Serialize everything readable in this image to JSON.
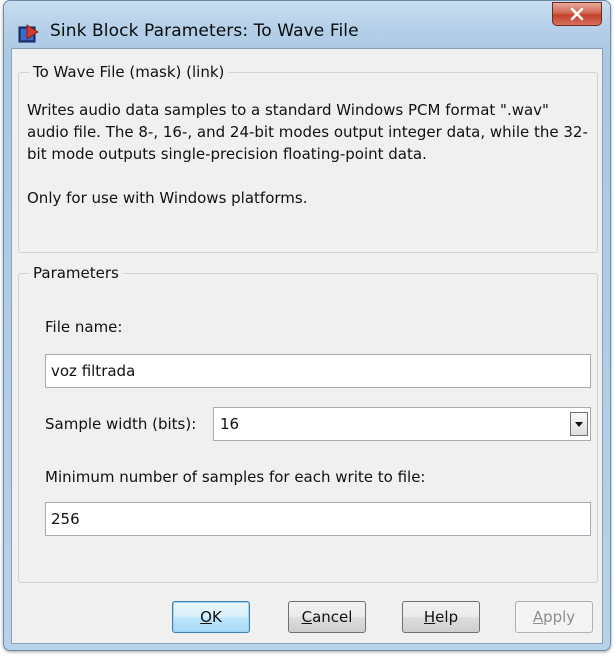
{
  "window": {
    "title": "Sink Block Parameters: To Wave File"
  },
  "description_group": {
    "legend": "To Wave File (mask) (link)",
    "paragraph1": "Writes audio data samples to a standard Windows PCM format \".wav\" audio file. The 8-, 16-, and 24-bit modes output integer data, while the 32-bit mode outputs single-precision floating-point data.",
    "paragraph2": "Only for use with Windows platforms."
  },
  "parameters_group": {
    "legend": "Parameters",
    "file_name": {
      "label": "File name:",
      "value": "voz filtrada"
    },
    "sample_width": {
      "label": "Sample width (bits):",
      "value": "16"
    },
    "min_samples": {
      "label": "Minimum number of samples for each write to file:",
      "value": "256"
    }
  },
  "buttons": {
    "ok": {
      "mnemonic": "O",
      "rest": "K"
    },
    "cancel": {
      "mnemonic": "C",
      "rest": "ancel"
    },
    "help": {
      "mnemonic": "H",
      "rest": "elp"
    },
    "apply": {
      "mnemonic": "A",
      "rest": "pply"
    }
  },
  "colors": {
    "close_button": "#c2412b",
    "default_button_border": "#3c7fb1",
    "disabled_text": "#8d8d8d"
  },
  "icons": {
    "app": "simulink-block-icon",
    "close": "close-x-icon",
    "dropdown": "chevron-down-icon"
  }
}
